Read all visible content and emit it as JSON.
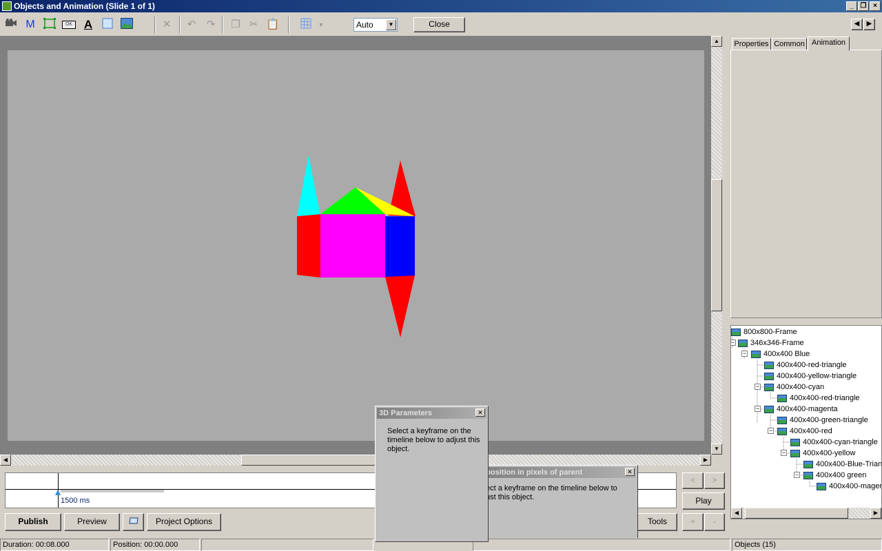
{
  "window": {
    "title": "Objects and Animation  (Slide 1 of 1)"
  },
  "toolbar": {
    "icons": [
      "camera-icon",
      "m-icon",
      "rectangle-select-icon",
      "ok-button-icon",
      "text-icon",
      "rectangle-icon",
      "image-icon",
      "delete-icon",
      "undo-icon",
      "redo-icon",
      "copy-icon",
      "cut-icon",
      "paste-icon",
      "grid-icon"
    ],
    "m_label": "M",
    "ok_label": "OK",
    "text_label": "A",
    "zoom_value": "Auto",
    "close_label": "Close"
  },
  "canvas": {
    "shape_colors": {
      "red": "#ff0000",
      "magenta": "#ff00ff",
      "blue": "#0000ff",
      "cyan": "#00ffff",
      "green": "#00ff00",
      "yellow": "#ffff00",
      "stage": "#aaaaaa"
    }
  },
  "tabs": [
    "Properties",
    "Common",
    "Animation"
  ],
  "active_tab": "Animation",
  "tree": [
    {
      "label": "800x800-Frame"
    },
    {
      "label": "346x346-Frame"
    },
    {
      "label": "400x400 Blue"
    },
    {
      "label": "400x400-red-triangle"
    },
    {
      "label": "400x400-yellow-triangle"
    },
    {
      "label": "400x400-cyan"
    },
    {
      "label": "400x400-red-triangle"
    },
    {
      "label": "400x400-magenta"
    },
    {
      "label": "400x400-green-triangle"
    },
    {
      "label": "400x400-red"
    },
    {
      "label": "400x400-cyan-triangle"
    },
    {
      "label": "400x400-yellow"
    },
    {
      "label": "400x400-Blue-Trian"
    },
    {
      "label": "400x400 green"
    },
    {
      "label": "400x400-mager"
    }
  ],
  "timeline": {
    "marker_label": "1500 ms"
  },
  "bottom": {
    "publish": "Publish",
    "preview": "Preview",
    "project_options": "Project Options",
    "tools": "Tools",
    "play": "Play",
    "prev": "<",
    "next": ">",
    "plus": "+",
    "minus": "-"
  },
  "dialogs": {
    "params": {
      "title": "3D Parameters",
      "text": "Select a keyframe on the timeline below to adjust this object."
    },
    "position": {
      "title": "e/position in pixels of parent",
      "line1": "ect a keyframe on the timeline below to",
      "line2": "ust this object."
    }
  },
  "status": {
    "duration": "Duration:  00:08.000",
    "position": "Position:  00:00.000",
    "objects": "Objects (15)"
  }
}
